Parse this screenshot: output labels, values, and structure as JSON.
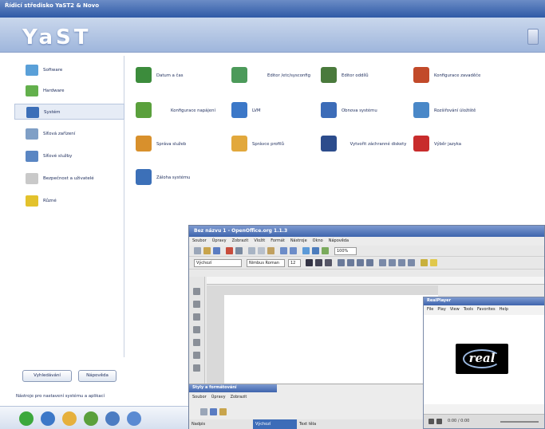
{
  "yast": {
    "window_title": "Řídicí středisko YaST2 & Novo",
    "logo": "YaST",
    "sidebar": [
      {
        "label": "Software",
        "icon": "software-package-icon",
        "color": "#5aa0d8"
      },
      {
        "label": "Hardware",
        "icon": "hardware-icon",
        "color": "#63b04c"
      },
      {
        "label": "Systém",
        "icon": "system-icon",
        "color": "#3c6fb8"
      },
      {
        "label": "Síťová zařízení",
        "icon": "network-devices-icon",
        "color": "#7f9fc6"
      },
      {
        "label": "Síťové služby",
        "icon": "network-services-icon",
        "color": "#5a86c3"
      },
      {
        "label": "Bezpečnost a uživatelé",
        "icon": "security-users-icon",
        "color": "#c9c9c9"
      },
      {
        "label": "Různé",
        "icon": "misc-icon",
        "color": "#e3c22c"
      }
    ],
    "selected_index": 2,
    "modules": [
      {
        "label": "Datum a čas",
        "icon": "clock-icon",
        "color": "#3c8c3c"
      },
      {
        "label": "Editor /etc/sysconfig",
        "icon": "sysconfig-editor-icon",
        "color": "#4c9a5a"
      },
      {
        "label": "Editor oddílů",
        "icon": "partitioner-icon",
        "color": "#4a7a3c"
      },
      {
        "label": "Konfigurace zavaděče",
        "icon": "bootloader-icon",
        "color": "#c24a2a"
      },
      {
        "label": "Konfigurace napájení",
        "icon": "power-icon",
        "color": "#5aa03c"
      },
      {
        "label": "LVM",
        "icon": "lvm-icon",
        "color": "#3c78c8"
      },
      {
        "label": "Obnova systému",
        "icon": "system-restore-icon",
        "color": "#3c6cb8"
      },
      {
        "label": "Rozšiřování úložiště",
        "icon": "storage-icon",
        "color": "#4a88c8"
      },
      {
        "label": "Správa služeb",
        "icon": "runlevel-icon",
        "color": "#d8902c"
      },
      {
        "label": "Správce profilů",
        "icon": "profile-manager-icon",
        "color": "#e2a83c"
      },
      {
        "label": "Vytvořit záchranné diskety",
        "icon": "floppy-icon",
        "color": "#2c4c8c"
      },
      {
        "label": "Výběr jazyka",
        "icon": "language-icon",
        "color": "#c82c2c"
      },
      {
        "label": "Záloha systému",
        "icon": "backup-icon",
        "color": "#3c70b8"
      }
    ],
    "buttons": {
      "search": "Vyhledávání",
      "help": "Nápověda"
    },
    "status_text": "Nástroje pro nastavení systému a aplikací",
    "taskbar_icons": [
      {
        "name": "start-icon",
        "color": "#3ca83c"
      },
      {
        "name": "browser-icon",
        "color": "#3c78c8"
      },
      {
        "name": "folder-icon",
        "color": "#e6b03c"
      },
      {
        "name": "settings-icon",
        "color": "#5aa03c"
      },
      {
        "name": "network-icon",
        "color": "#4c7cc2"
      },
      {
        "name": "help-icon",
        "color": "#5a8ad2"
      }
    ]
  },
  "openoffice": {
    "title": "Bez názvu 1 - OpenOffice.org 1.1.3",
    "menu": [
      "Soubor",
      "Úpravy",
      "Zobrazit",
      "Vložit",
      "Formát",
      "Nástroje",
      "Okno",
      "Nápověda"
    ],
    "zoom": "100%",
    "paragraph_style": "Výchozí",
    "font_name": "Nimbus Roman",
    "font_size": "12"
  },
  "realplayer": {
    "title": "RealPlayer",
    "menu": [
      "File",
      "Play",
      "View",
      "Tools",
      "Favorites",
      "Help"
    ],
    "logo": "real",
    "time": "0:00 / 0:00"
  },
  "styles_panel": {
    "title": "Styly a formátování",
    "menu": [
      "Soubor",
      "Úpravy",
      "Zobrazit"
    ],
    "row": [
      "Nadpis",
      "Výchozí",
      "Text těla"
    ]
  }
}
